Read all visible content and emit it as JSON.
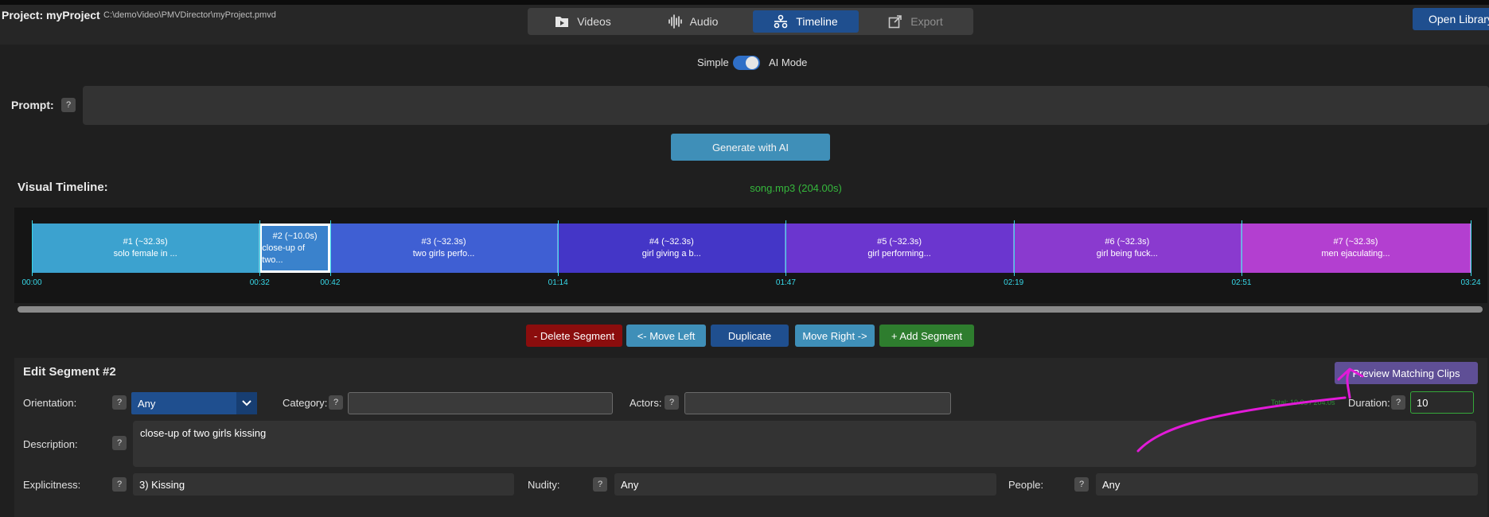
{
  "header": {
    "project_title": "Project: myProject",
    "project_path": "C:\\demoVideo\\PMVDirector\\myProject.pmvd",
    "tabs": [
      {
        "label": "Videos",
        "icon": "folder-play-icon",
        "state": "normal"
      },
      {
        "label": "Audio",
        "icon": "waveform-icon",
        "state": "normal"
      },
      {
        "label": "Timeline",
        "icon": "timeline-icon",
        "state": "active"
      },
      {
        "label": "Export",
        "icon": "export-icon",
        "state": "disabled"
      }
    ],
    "open_library_label": "Open Library"
  },
  "mode": {
    "simple_label": "Simple",
    "ai_label": "AI Mode",
    "ai_enabled": true
  },
  "prompt": {
    "label": "Prompt:",
    "help": "?",
    "value": ""
  },
  "generate_label": "Generate with AI",
  "timeline": {
    "label": "Visual Timeline:",
    "song": "song.mp3 (204.00s)",
    "segments": [
      {
        "title": "#1 (~32.3s)",
        "desc": "solo female in ...",
        "start": 0,
        "end": 32.3,
        "color": "#3ca2cf",
        "selected": false
      },
      {
        "title": "#2 (~10.0s)",
        "desc": "close-up of two...",
        "start": 32.3,
        "end": 42.3,
        "color": "#3a82cc",
        "selected": true
      },
      {
        "title": "#3 (~32.3s)",
        "desc": "two girls perfo...",
        "start": 42.3,
        "end": 74.6,
        "color": "#3f5fd3",
        "selected": false
      },
      {
        "title": "#4 (~32.3s)",
        "desc": "girl giving a b...",
        "start": 74.6,
        "end": 106.9,
        "color": "#4436c7",
        "selected": false
      },
      {
        "title": "#5 (~32.3s)",
        "desc": "girl performing...",
        "start": 106.9,
        "end": 139.2,
        "color": "#6b36cf",
        "selected": false
      },
      {
        "title": "#6 (~32.3s)",
        "desc": "girl being fuck...",
        "start": 139.2,
        "end": 171.5,
        "color": "#8a3acf",
        "selected": false
      },
      {
        "title": "#7 (~32.3s)",
        "desc": "men ejaculating...",
        "start": 171.5,
        "end": 204.0,
        "color": "#b33fd0",
        "selected": false
      }
    ],
    "ticks": [
      {
        "t": 0,
        "label": "00:00"
      },
      {
        "t": 32.3,
        "label": "00:32"
      },
      {
        "t": 42.3,
        "label": "00:42"
      },
      {
        "t": 74.6,
        "label": "01:14"
      },
      {
        "t": 106.9,
        "label": "01:47"
      },
      {
        "t": 139.2,
        "label": "02:19"
      },
      {
        "t": 171.5,
        "label": "02:51"
      },
      {
        "t": 204.0,
        "label": "03:24"
      }
    ],
    "total_seconds": 204.0
  },
  "actions": {
    "delete": "- Delete Segment",
    "move_left": "<- Move Left",
    "duplicate": "Duplicate",
    "move_right": "Move Right ->",
    "add": "+ Add Segment"
  },
  "edit": {
    "title": "Edit Segment #2",
    "preview_label": "Preview Matching Clips",
    "orientation_label": "Orientation:",
    "orientation_value": "Any",
    "category_label": "Category:",
    "category_value": "",
    "actors_label": "Actors:",
    "actors_value": "",
    "total_text": "Total: 10.0s / 204.0s",
    "duration_label": "Duration:",
    "duration_value": "10",
    "description_label": "Description:",
    "description_value": "close-up of two girls kissing",
    "explicitness_label": "Explicitness:",
    "explicitness_value": "3) Kissing",
    "nudity_label": "Nudity:",
    "nudity_value": "Any",
    "people_label": "People:",
    "people_value": "Any",
    "help": "?"
  },
  "colors": {
    "accent": "#1f4f8f",
    "timeline_tick": "#37d8e8",
    "annotation": "#e21ad8"
  }
}
